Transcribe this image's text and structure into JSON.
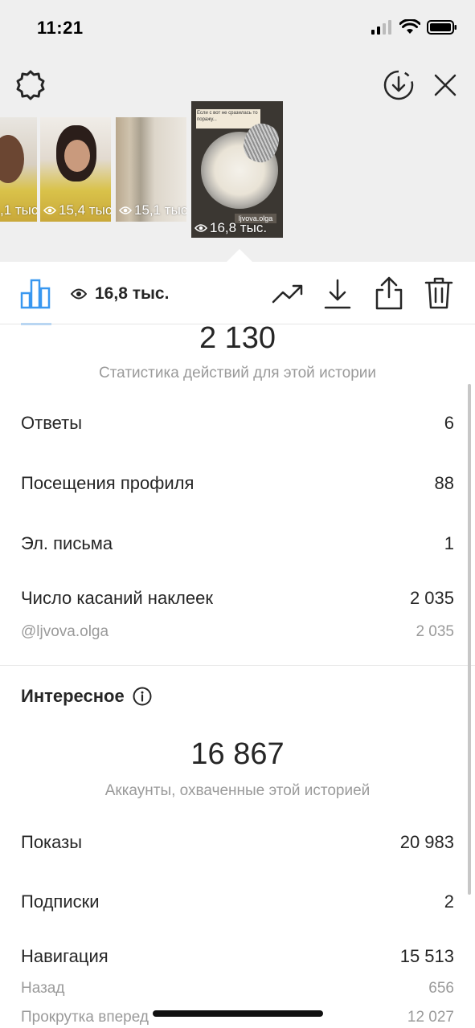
{
  "status_bar": {
    "time": "11:21"
  },
  "story_thumbnails": [
    {
      "views": ",1 тыс"
    },
    {
      "views": "15,4 тыс"
    },
    {
      "views": "15,1 тыс"
    },
    {
      "views": "16,8 тыс.",
      "sticker_text": "ljvova.olga",
      "caption_text": "Если с вот не сразилась то поражу..."
    }
  ],
  "action_bar": {
    "views": "16,8 тыс."
  },
  "actions_section": {
    "total": "2 130",
    "caption": "Статистика действий для этой истории",
    "rows": [
      {
        "label": "Ответы",
        "value": "6"
      },
      {
        "label": "Посещения профиля",
        "value": "88"
      },
      {
        "label": "Эл. письма",
        "value": "1"
      },
      {
        "label": "Число касаний наклеек",
        "value": "2 035"
      }
    ],
    "sub_row": {
      "label": "@ljvova.olga",
      "value": "2 035"
    }
  },
  "discovery_section": {
    "title": "Интересное",
    "total": "16 867",
    "caption": "Аккаунты, охваченные этой историей",
    "rows": [
      {
        "label": "Показы",
        "value": "20 983"
      },
      {
        "label": "Подписки",
        "value": "2"
      },
      {
        "label": "Навигация",
        "value": "15 513"
      }
    ],
    "sub_rows": [
      {
        "label": "Назад",
        "value": "656"
      },
      {
        "label": "Прокрутка вперед",
        "value": "12 027"
      }
    ]
  },
  "colors": {
    "accent": "#3897f0",
    "text": "#262626",
    "muted": "#9a9a9a",
    "top_bg": "#efefef"
  }
}
